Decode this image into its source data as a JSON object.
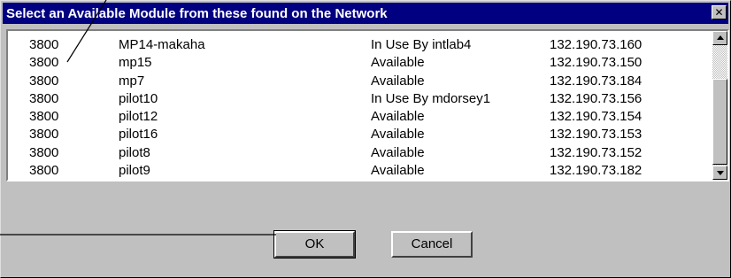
{
  "dialog": {
    "title": "Select an Available Module from these found on the Network",
    "close_label": "✕"
  },
  "modules": [
    {
      "model": "3800",
      "name": "MP14-makaha",
      "status": "In Use By intlab4",
      "ip": "132.190.73.160"
    },
    {
      "model": "3800",
      "name": "mp15",
      "status": "Available",
      "ip": "132.190.73.150"
    },
    {
      "model": "3800",
      "name": "mp7",
      "status": "Available",
      "ip": "132.190.73.184"
    },
    {
      "model": "3800",
      "name": "pilot10",
      "status": "In Use By mdorsey1",
      "ip": "132.190.73.156"
    },
    {
      "model": "3800",
      "name": "pilot12",
      "status": "Available",
      "ip": "132.190.73.154"
    },
    {
      "model": "3800",
      "name": "pilot16",
      "status": "Available",
      "ip": "132.190.73.153"
    },
    {
      "model": "3800",
      "name": "pilot8",
      "status": "Available",
      "ip": "132.190.73.152"
    },
    {
      "model": "3800",
      "name": "pilot9",
      "status": "Available",
      "ip": "132.190.73.182"
    }
  ],
  "buttons": {
    "ok_label": "OK",
    "cancel_label": "Cancel"
  },
  "icons": {
    "close": "close-icon",
    "scroll_up": "scroll-up-arrow-icon",
    "scroll_down": "scroll-down-arrow-icon"
  },
  "colors": {
    "titlebar": "#000080",
    "face": "#c0c0c0",
    "list_bg": "#ffffff"
  }
}
